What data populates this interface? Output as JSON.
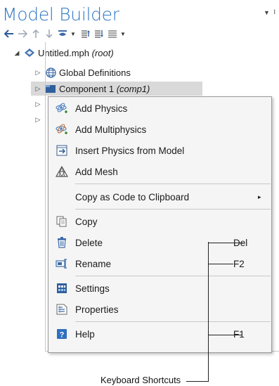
{
  "header": {
    "title": "Model Builder",
    "menu_arrow": "▼",
    "menu_extra": "ı"
  },
  "toolbar": {
    "buttons": [
      "back-arrow-icon",
      "forward-arrow-icon",
      "move-up-icon",
      "move-down-icon",
      "show-icon",
      "expand-sections-icon",
      "collapse-sections-icon",
      "build-icon"
    ]
  },
  "tree": {
    "root_label": "Untitled.mph",
    "root_tag": "(root)",
    "global_label": "Global Definitions",
    "component_label": "Component 1",
    "component_tag": "(comp1)"
  },
  "context_menu": {
    "add_physics": "Add Physics",
    "add_multiphysics": "Add Multiphysics",
    "insert_physics": "Insert Physics from Model",
    "add_mesh": "Add Mesh",
    "copy_as_code": "Copy as Code to Clipboard",
    "copy": "Copy",
    "delete": "Delete",
    "delete_key": "Del",
    "rename": "Rename",
    "rename_key": "F2",
    "settings": "Settings",
    "properties": "Properties",
    "help": "Help",
    "help_key": "F1",
    "submenu_arrow": "▸"
  },
  "callout": {
    "label": "Keyboard Shortcuts"
  },
  "colors": {
    "title_blue": "#2e76c4",
    "selection_gray": "#d9d9d9",
    "menu_bg": "#f5f5f5"
  }
}
